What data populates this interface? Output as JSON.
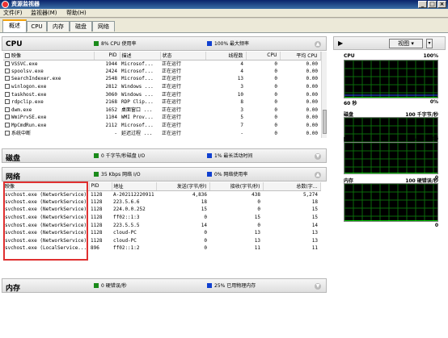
{
  "window": {
    "title": "资源监视器"
  },
  "menu": [
    "文件(F)",
    "监视器(M)",
    "帮助(H)"
  ],
  "tabs": [
    "概述",
    "CPU",
    "内存",
    "磁盘",
    "网络"
  ],
  "colors": {
    "green": "#1a8a1a",
    "blue": "#1040d0",
    "graph_line": "#00ff00",
    "highlight": "#e03030"
  },
  "cpu": {
    "title": "CPU",
    "ind1": "8% CPU 使用率",
    "ind2": "100% 最大频率",
    "columns": [
      "映像",
      "PID",
      "描述",
      "状态",
      "线程数",
      "CPU",
      "平均 CPU"
    ],
    "rows": [
      [
        "VSSVC.exe",
        "1944",
        "Microsof...",
        "正在运行",
        "4",
        "0",
        "0.00"
      ],
      [
        "spoolsv.exe",
        "2424",
        "Microsof...",
        "正在运行",
        "4",
        "0",
        "0.00"
      ],
      [
        "SearchIndexer.exe",
        "2548",
        "Microsof...",
        "正在运行",
        "13",
        "0",
        "0.00"
      ],
      [
        "winlogon.exe",
        "2812",
        "Windows ...",
        "正在运行",
        "3",
        "0",
        "0.00"
      ],
      [
        "taskhost.exe",
        "3060",
        "Windows ...",
        "正在运行",
        "10",
        "0",
        "0.00"
      ],
      [
        "rdpclip.exe",
        "2168",
        "RDP Clip...",
        "正在运行",
        "8",
        "0",
        "0.00"
      ],
      [
        "dwm.exe",
        "1652",
        "桌面窗口 ...",
        "正在运行",
        "3",
        "0",
        "0.00"
      ],
      [
        "WmiPrvSE.exe",
        "1104",
        "WMI Prov...",
        "正在运行",
        "5",
        "0",
        "0.00"
      ],
      [
        "MpCmdRun.exe",
        "2112",
        "Microsof...",
        "正在运行",
        "7",
        "0",
        "0.00"
      ],
      [
        "系统中断",
        "-",
        "延迟过程 ...",
        "正在运行",
        "-",
        "0",
        "0.00"
      ]
    ]
  },
  "disk": {
    "title": "磁盘",
    "ind1": "0 千字节/秒磁盘 I/O",
    "ind2": "1% 最长活动时间"
  },
  "network": {
    "title": "网络",
    "ind1": "35 Kbps 网络 I/O",
    "ind2": "0% 网络使用率",
    "columns": [
      "映像",
      "PID",
      "地址",
      "发送(字节/秒)",
      "接收(字节/秒)",
      "总数(字..."
    ],
    "rows": [
      [
        "svchost.exe (NetworkService)",
        "1128",
        "A-202112220911",
        "4,836",
        "438",
        "5,274"
      ],
      [
        "svchost.exe (NetworkService)",
        "1128",
        "223.5.6.6",
        "18",
        "0",
        "18"
      ],
      [
        "svchost.exe (NetworkService)",
        "1128",
        "224.0.0.252",
        "15",
        "0",
        "15"
      ],
      [
        "svchost.exe (NetworkService)",
        "1128",
        "ff02::1:3",
        "0",
        "15",
        "15"
      ],
      [
        "svchost.exe (NetworkService)",
        "1128",
        "223.5.5.5",
        "14",
        "0",
        "14"
      ],
      [
        "svchost.exe (NetworkService)",
        "1128",
        "cloud-PC",
        "0",
        "13",
        "13"
      ],
      [
        "svchost.exe (NetworkService)",
        "1128",
        "cloud-PC",
        "0",
        "13",
        "13"
      ],
      [
        "svchost.exe (LocalService...",
        "896",
        "ff02::1:2",
        "0",
        "11",
        "11"
      ]
    ]
  },
  "memory": {
    "title": "内存",
    "ind1": "0 硬错误/秒",
    "ind2": "25% 已用物理内存"
  },
  "right": {
    "view_label": "视图",
    "graphs": [
      {
        "name": "CPU",
        "max": "100%",
        "bottom_left": "60 秒",
        "bottom_right": "0%"
      },
      {
        "name": "磁盘",
        "max": "100 千字节/秒",
        "bottom_left": "",
        "bottom_right": "0"
      },
      {
        "name": "网络",
        "max": "100 Kbps",
        "bottom_left": "",
        "bottom_right": "0"
      },
      {
        "name": "内存",
        "max": "100 硬错误/秒",
        "bottom_left": "",
        "bottom_right": "0"
      }
    ]
  }
}
